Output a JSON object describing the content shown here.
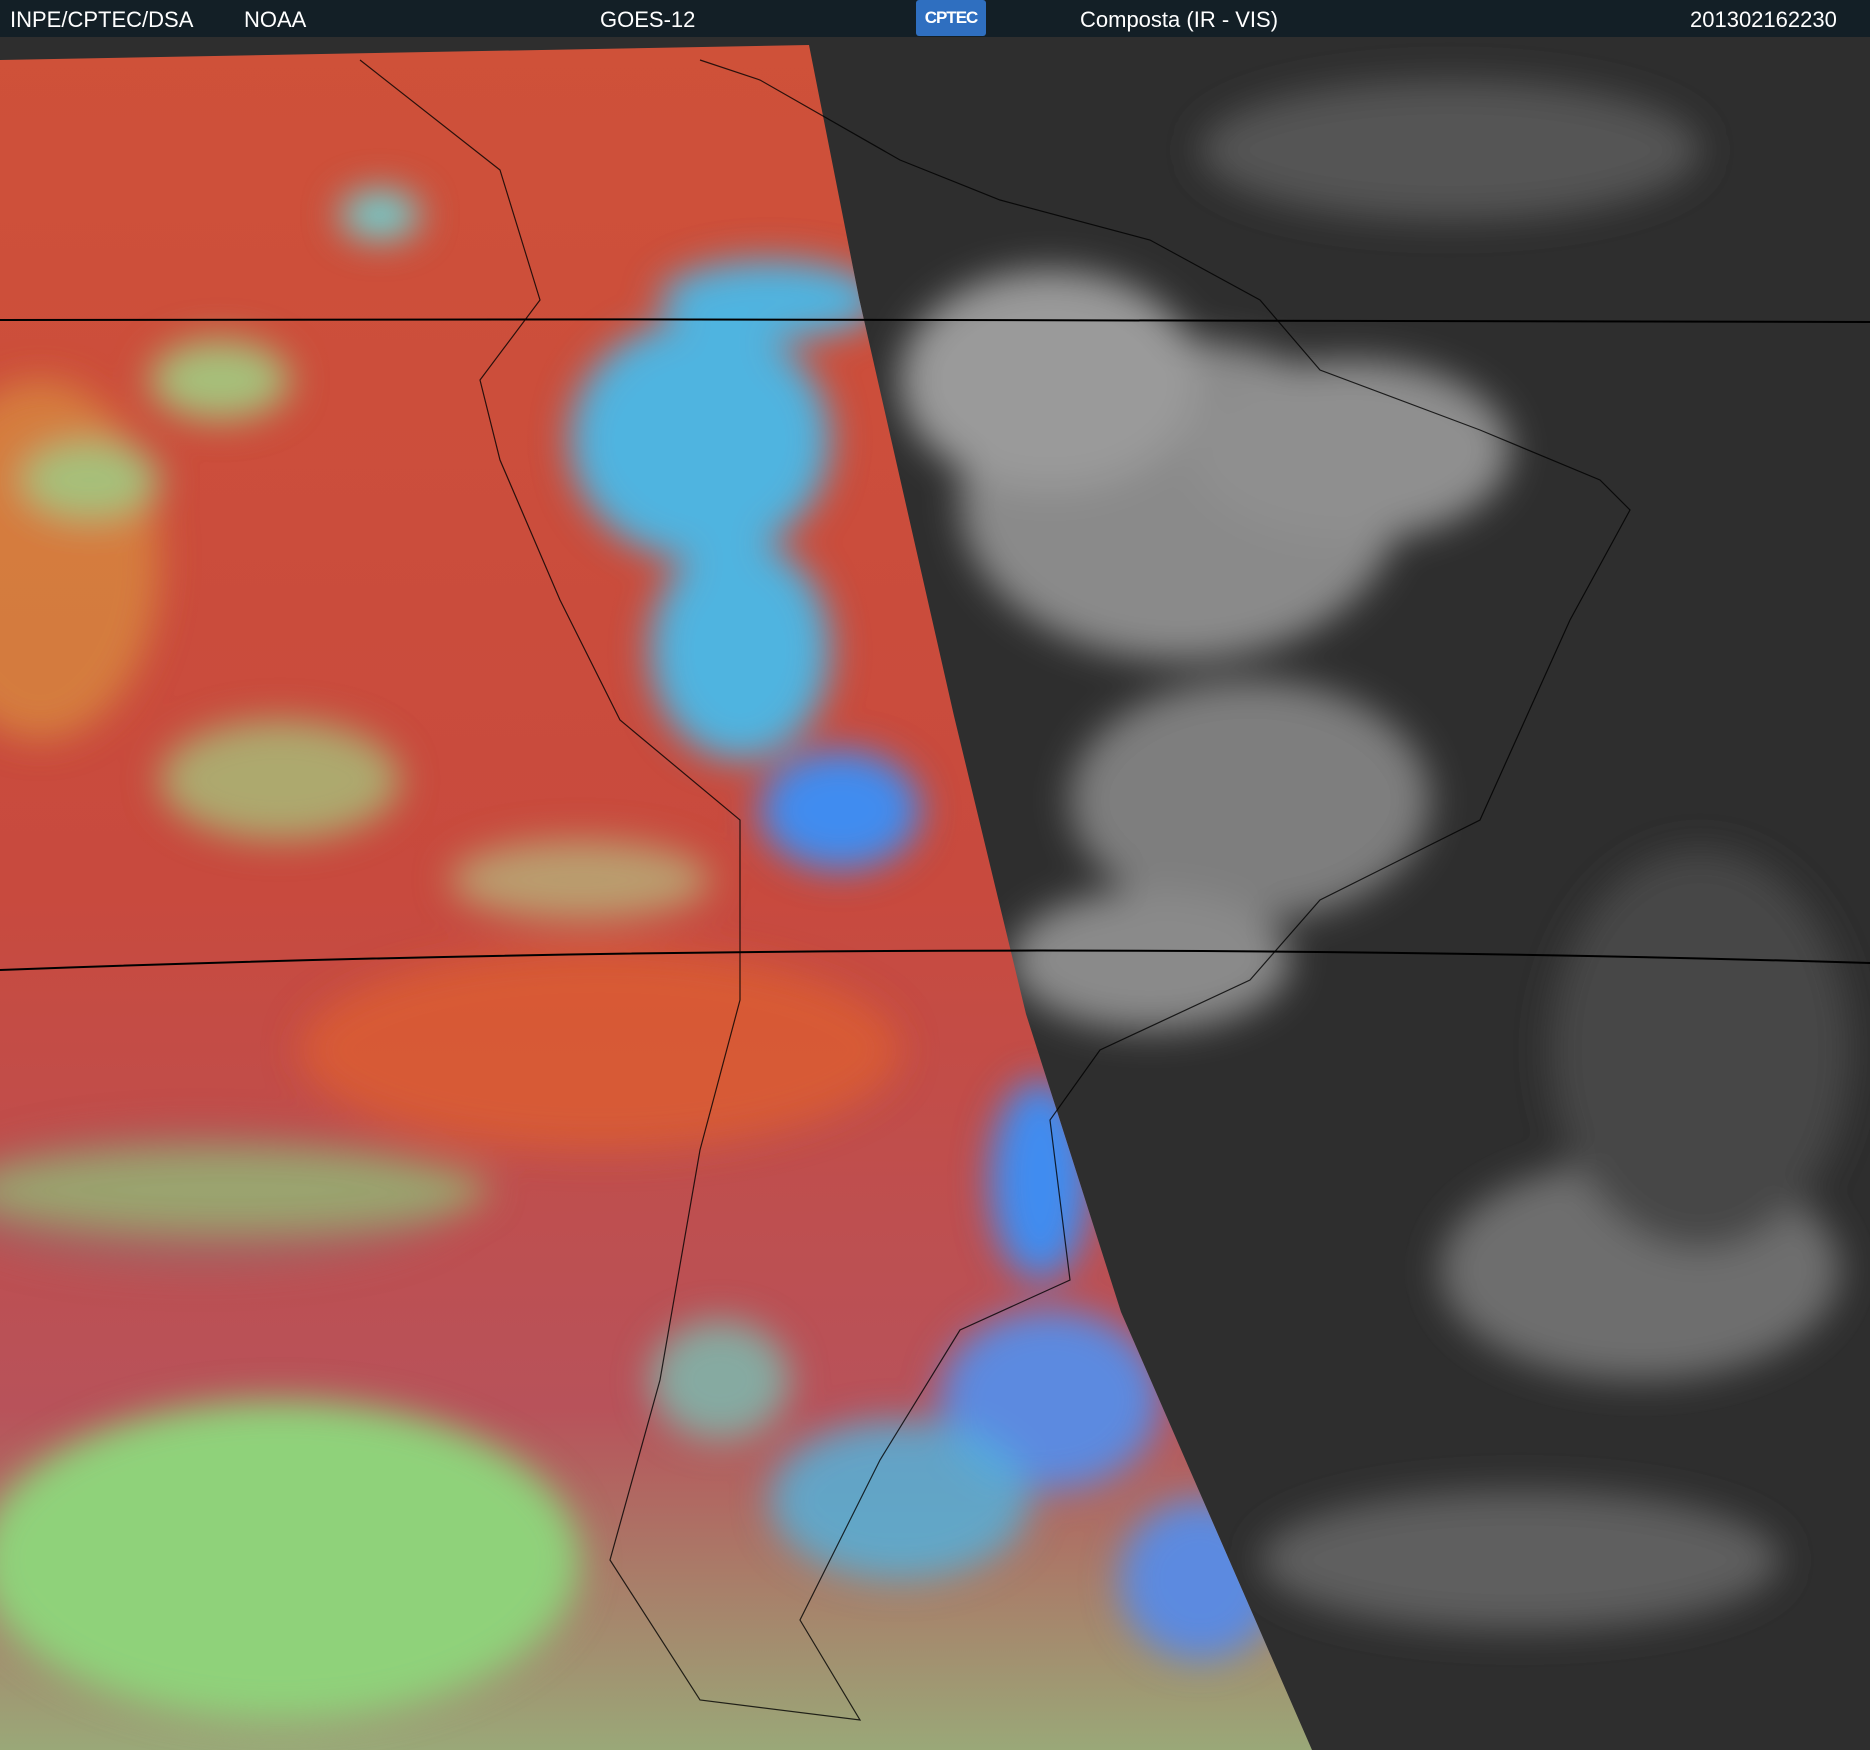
{
  "header": {
    "institution": "INPE/CPTEC/DSA",
    "agency": "NOAA",
    "satellite": "GOES-12",
    "logo_text": "CPTEC",
    "product": "Composta (IR - VIS)",
    "timestamp": "201302162230"
  },
  "colors": {
    "header_bg": "#131f26",
    "ir_warm": "#c9473a",
    "ir_cloud_green": "#8fd27a",
    "ir_cloud_blue": "#3f8cf0",
    "vis_background": "#2e2e2e"
  }
}
